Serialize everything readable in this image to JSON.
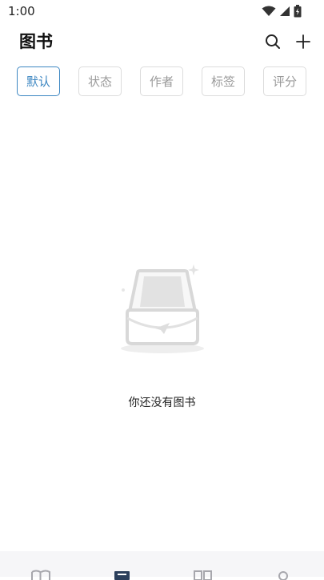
{
  "status_bar": {
    "time": "1:00",
    "icons": [
      "wifi-icon",
      "cellular-signal-icon",
      "battery-icon"
    ]
  },
  "header": {
    "title": "图书",
    "actions": [
      "search-icon",
      "add-icon"
    ]
  },
  "filters": {
    "items": [
      {
        "label": "默认",
        "active": true
      },
      {
        "label": "状态",
        "active": false
      },
      {
        "label": "作者",
        "active": false
      },
      {
        "label": "标签",
        "active": false
      },
      {
        "label": "评分",
        "active": false
      }
    ],
    "active_color": "#3d87c2"
  },
  "empty_state": {
    "icon": "empty-inbox-icon",
    "message": "你还没有图书"
  },
  "bottom_nav": {
    "items": [
      {
        "icon": "open-book-icon",
        "active": false
      },
      {
        "icon": "bookshelf-icon",
        "active": true
      },
      {
        "icon": "columns-icon",
        "active": false
      },
      {
        "icon": "profile-icon",
        "active": false
      }
    ]
  }
}
